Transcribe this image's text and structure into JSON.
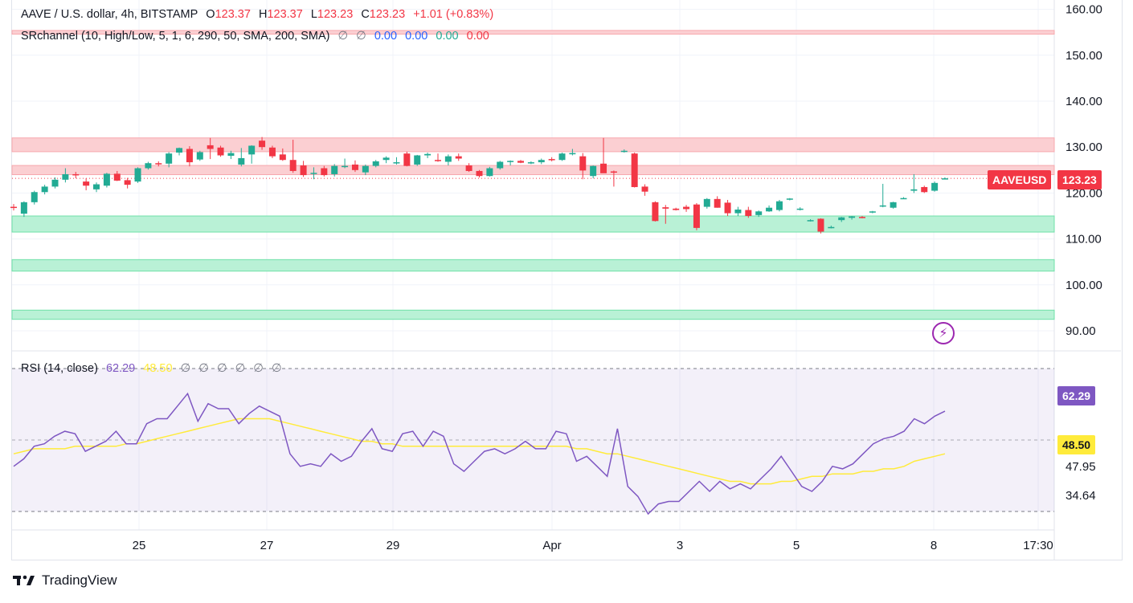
{
  "legend": {
    "symbol": "AAVE / U.S. dollar, 4h, BITSTAMP",
    "o_label": "O",
    "o": "123.37",
    "h_label": "H",
    "h": "123.37",
    "l_label": "L",
    "l": "123.23",
    "c_label": "C",
    "c": "123.23",
    "change": "+1.01 (+0.83%)"
  },
  "sr_legend": {
    "name": "SRchannel (10, High/Low, 5, 1, 6, 290, 50, SMA, 200, SMA)",
    "v1": "∅",
    "v2": "∅",
    "v3": "0.00",
    "v4": "0.00",
    "v5": "0.00",
    "v6": "0.00"
  },
  "rsi_legend": {
    "name": "RSI (14, close)",
    "rsi": "62.29",
    "ma": "48.50",
    "empties": [
      "∅",
      "∅",
      "∅",
      "∅",
      "∅",
      "∅"
    ]
  },
  "tags": {
    "symbol_tag": "AAVEUSD",
    "price_tag": "123.23",
    "rsi_tag": "62.29",
    "rsima_tag": "48.50",
    "rsi_level_a": "47.95",
    "rsi_level_b": "34.64"
  },
  "footer": {
    "brand": "TradingView"
  },
  "colors": {
    "up": "#22ab94",
    "down": "#f23645",
    "rsi": "#7e57c2",
    "rsi_ma": "#ffeb3b",
    "support": "#b2f2d4",
    "resistance": "#fbcfd2"
  },
  "chart_data": [
    {
      "type": "candlestick",
      "price_axis_ticks": [
        "160.00",
        "150.00",
        "140.00",
        "130.00",
        "120.00",
        "110.00",
        "100.00",
        "90.00"
      ],
      "ylim": [
        87,
        162
      ],
      "time_axis_ticks": [
        "25",
        "27",
        "29",
        "Apr",
        "3",
        "5",
        "8",
        "17:30"
      ],
      "resistance_zones": [
        [
          129.0,
          132.0
        ],
        [
          124.0,
          126.0
        ],
        [
          154.6,
          155.4
        ]
      ],
      "support_zones": [
        [
          111.5,
          115.0
        ],
        [
          103.0,
          105.5
        ],
        [
          92.5,
          94.5
        ]
      ],
      "candles": [
        [
          117.0,
          117.6,
          116.2,
          116.8
        ],
        [
          115.5,
          118.2,
          114.8,
          118.0
        ],
        [
          118.0,
          120.5,
          117.5,
          120.2
        ],
        [
          120.2,
          121.8,
          119.7,
          121.4
        ],
        [
          121.4,
          123.4,
          121.0,
          122.9
        ],
        [
          122.9,
          125.4,
          122.3,
          124.1
        ],
        [
          124.1,
          124.6,
          123.2,
          123.9
        ],
        [
          122.5,
          123.2,
          120.6,
          121.6
        ],
        [
          120.8,
          122.3,
          120.2,
          121.9
        ],
        [
          121.6,
          124.4,
          121.2,
          124.2
        ],
        [
          124.2,
          124.8,
          122.6,
          122.7
        ],
        [
          122.8,
          123.3,
          121.0,
          121.8
        ],
        [
          122.5,
          125.6,
          122.2,
          125.4
        ],
        [
          125.4,
          126.8,
          125.1,
          126.5
        ],
        [
          126.5,
          126.9,
          125.8,
          126.4
        ],
        [
          126.4,
          128.9,
          125.6,
          128.6
        ],
        [
          128.8,
          129.9,
          128.2,
          129.8
        ],
        [
          129.6,
          130.2,
          125.8,
          126.7
        ],
        [
          127.3,
          129.2,
          127.0,
          128.9
        ],
        [
          130.4,
          132.0,
          127.4,
          129.6
        ],
        [
          129.9,
          130.3,
          127.9,
          128.2
        ],
        [
          128.1,
          129.2,
          127.4,
          128.7
        ],
        [
          126.2,
          129.8,
          125.8,
          127.6
        ],
        [
          128.4,
          130.4,
          126.4,
          130.3
        ],
        [
          131.4,
          132.2,
          129.4,
          130.0
        ],
        [
          129.9,
          130.3,
          127.6,
          128.0
        ],
        [
          128.4,
          129.7,
          127.0,
          127.2
        ],
        [
          127.2,
          131.6,
          124.4,
          124.8
        ],
        [
          126.0,
          127.0,
          123.5,
          123.9
        ],
        [
          124.2,
          125.6,
          123.0,
          124.4
        ],
        [
          125.4,
          125.9,
          123.6,
          123.9
        ],
        [
          124.1,
          126.3,
          123.6,
          125.9
        ],
        [
          125.9,
          127.5,
          125.4,
          125.9
        ],
        [
          126.2,
          127.1,
          124.6,
          125.0
        ],
        [
          124.5,
          126.2,
          123.9,
          125.9
        ],
        [
          125.9,
          127.2,
          125.6,
          126.9
        ],
        [
          127.2,
          128.0,
          126.5,
          127.7
        ],
        [
          126.7,
          127.8,
          126.2,
          126.7
        ],
        [
          128.6,
          129.0,
          125.8,
          125.9
        ],
        [
          126.2,
          128.3,
          125.9,
          128.2
        ],
        [
          128.2,
          128.8,
          127.6,
          128.5
        ],
        [
          127.2,
          128.6,
          126.8,
          127.1
        ],
        [
          126.8,
          128.4,
          126.0,
          128.0
        ],
        [
          128.0,
          128.6,
          127.0,
          127.5
        ],
        [
          126.0,
          126.5,
          124.6,
          124.8
        ],
        [
          124.8,
          125.0,
          123.4,
          123.7
        ],
        [
          123.7,
          125.7,
          123.6,
          125.4
        ],
        [
          125.4,
          127.0,
          125.1,
          126.8
        ],
        [
          126.8,
          127.1,
          126.0,
          127.0
        ],
        [
          127.0,
          127.2,
          126.5,
          126.6
        ],
        [
          126.6,
          126.9,
          126.3,
          126.7
        ],
        [
          126.7,
          127.5,
          126.3,
          127.2
        ],
        [
          127.4,
          127.8,
          126.9,
          127.2
        ],
        [
          127.2,
          128.8,
          127.0,
          128.6
        ],
        [
          128.6,
          129.6,
          128.2,
          128.7
        ],
        [
          128.0,
          128.7,
          123.0,
          124.9
        ],
        [
          123.7,
          126.0,
          123.2,
          125.9
        ],
        [
          126.4,
          132.0,
          125.2,
          124.3
        ],
        [
          124.7,
          124.9,
          121.4,
          124.6
        ],
        [
          129.1,
          129.5,
          128.8,
          129.2
        ],
        [
          128.6,
          128.8,
          121.2,
          121.3
        ],
        [
          121.4,
          121.9,
          119.4,
          120.3
        ],
        [
          118.0,
          118.2,
          113.8,
          113.9
        ],
        [
          116.9,
          117.4,
          113.3,
          116.6
        ],
        [
          116.6,
          116.8,
          116.2,
          116.3
        ],
        [
          117.0,
          117.4,
          115.9,
          116.5
        ],
        [
          117.5,
          117.8,
          111.9,
          112.4
        ],
        [
          117.0,
          118.9,
          116.6,
          118.7
        ],
        [
          118.7,
          119.3,
          116.8,
          116.8
        ],
        [
          117.9,
          118.5,
          115.0,
          115.6
        ],
        [
          115.6,
          117.0,
          115.0,
          116.4
        ],
        [
          116.3,
          117.0,
          114.6,
          115.0
        ],
        [
          115.2,
          116.2,
          114.8,
          116.0
        ],
        [
          116.0,
          117.3,
          115.9,
          116.8
        ],
        [
          116.3,
          118.5,
          116.0,
          118.2
        ],
        [
          118.8,
          118.9,
          118.4,
          118.8
        ],
        [
          116.4,
          116.9,
          116.2,
          116.6
        ],
        [
          114.0,
          114.3,
          113.8,
          114.1
        ],
        [
          114.4,
          114.5,
          111.2,
          111.6
        ],
        [
          112.5,
          112.9,
          112.3,
          112.6
        ],
        [
          114.1,
          114.8,
          113.7,
          114.7
        ],
        [
          114.6,
          115.0,
          114.2,
          114.9
        ],
        [
          114.8,
          115.0,
          114.5,
          114.6
        ],
        [
          115.8,
          116.1,
          115.6,
          116.0
        ],
        [
          117.2,
          122.0,
          116.9,
          117.3
        ],
        [
          116.8,
          118.1,
          116.6,
          118.0
        ],
        [
          118.8,
          119.1,
          118.7,
          118.9
        ],
        [
          120.5,
          124.1,
          120.0,
          120.8
        ],
        [
          121.3,
          121.6,
          120.0,
          120.2
        ],
        [
          120.5,
          122.5,
          120.3,
          122.2
        ],
        [
          123.2,
          123.4,
          123.0,
          123.2
        ]
      ]
    },
    {
      "type": "line",
      "name": "RSI (14, close)",
      "ylim": [
        25,
        82
      ],
      "visible_levels": [
        "47.95",
        "34.64"
      ],
      "series": [
        {
          "name": "RSI",
          "values": [
            43,
            46,
            51,
            52,
            55,
            57,
            56,
            49,
            51,
            53,
            57,
            52,
            52,
            60,
            62,
            62,
            67,
            72,
            61,
            68,
            66,
            66,
            60,
            64,
            67,
            65,
            63,
            48,
            43,
            44,
            43,
            48,
            45,
            47,
            53,
            58,
            50,
            49,
            56,
            57,
            51,
            57,
            55,
            44,
            41,
            45,
            49,
            50,
            48,
            50,
            53,
            50,
            50,
            57,
            56,
            45,
            47,
            43,
            39,
            58,
            35,
            31,
            24,
            28,
            29,
            29,
            33,
            37,
            33,
            37,
            34,
            36,
            34,
            38,
            42,
            47,
            41,
            35,
            33,
            37,
            43,
            42,
            44,
            48,
            52,
            54,
            55,
            57,
            62,
            60,
            63,
            65
          ]
        },
        {
          "name": "MA",
          "values": [
            48,
            49,
            50,
            50,
            50,
            50,
            51,
            51,
            51,
            51,
            51,
            52,
            52,
            53,
            54,
            55,
            56,
            57,
            58,
            59,
            60,
            61,
            62,
            62,
            62,
            62,
            61,
            60,
            59,
            58,
            57,
            56,
            55,
            54,
            53,
            53,
            52,
            52,
            51,
            51,
            51,
            51,
            51,
            51,
            51,
            51,
            51,
            51,
            51,
            51,
            51,
            51,
            51,
            51,
            51,
            50,
            50,
            49,
            48,
            48,
            47,
            46,
            45,
            44,
            43,
            42,
            41,
            40,
            39,
            38,
            37,
            37,
            36,
            36,
            36,
            37,
            37,
            38,
            39,
            39,
            40,
            40,
            40,
            41,
            41,
            42,
            42,
            43,
            45,
            46,
            47,
            48
          ]
        }
      ]
    }
  ]
}
